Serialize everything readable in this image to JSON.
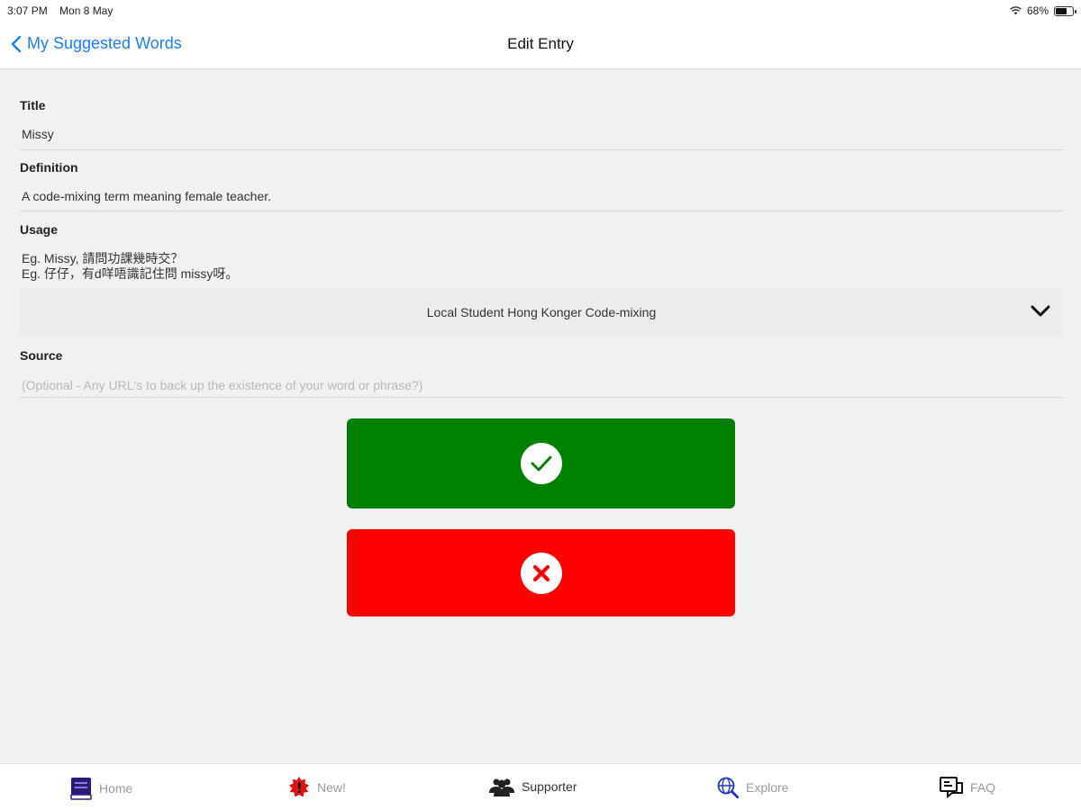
{
  "status_bar": {
    "time": "3:07 PM",
    "date": "Mon 8 May",
    "battery": "68%",
    "battery_level": 0.68
  },
  "nav": {
    "back_label": "My Suggested Words",
    "title": "Edit Entry"
  },
  "form": {
    "title_label": "Title",
    "title_value": "Missy",
    "definition_label": "Definition",
    "definition_value": "A code-mixing term meaning female teacher.",
    "usage_label": "Usage",
    "usage_line1": "Eg. Missy, 請問功課幾時交？",
    "usage_line2": "Eg. 仔仔，有d咩唔識記住問 missy呀。",
    "category_value": "Local Student Hong Konger Code-mixing",
    "source_label": "Source",
    "source_placeholder": "(Optional - Any URL's to back up the existence of your word or phrase?)"
  },
  "actions": {
    "confirm_color": "#008000",
    "cancel_color": "#ff0000"
  },
  "tabs": [
    {
      "label": "Home",
      "icon": "book-icon"
    },
    {
      "label": "New!",
      "icon": "new-badge-icon"
    },
    {
      "label": "Supporter",
      "icon": "people-icon"
    },
    {
      "label": "Explore",
      "icon": "globe-search-icon"
    },
    {
      "label": "FAQ",
      "icon": "faq-icon"
    }
  ],
  "colors": {
    "accent": "#1a7cff"
  }
}
